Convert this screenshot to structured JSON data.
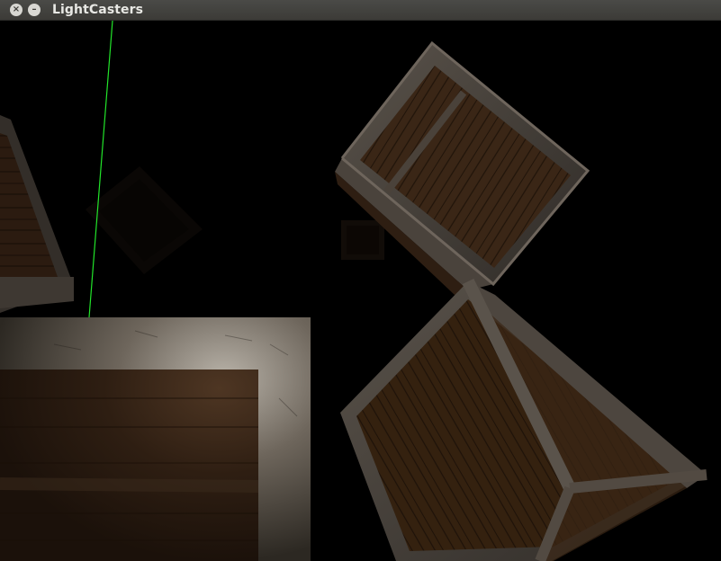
{
  "window": {
    "title": "LightCasters",
    "close_icon": "close-icon",
    "minimize_icon": "minimize-icon"
  },
  "scene": {
    "background_color": "#000000",
    "light_ray_color": "#22e52a",
    "crate_wood_color": "#5a3d24",
    "crate_frame_color": "#7d7268"
  }
}
